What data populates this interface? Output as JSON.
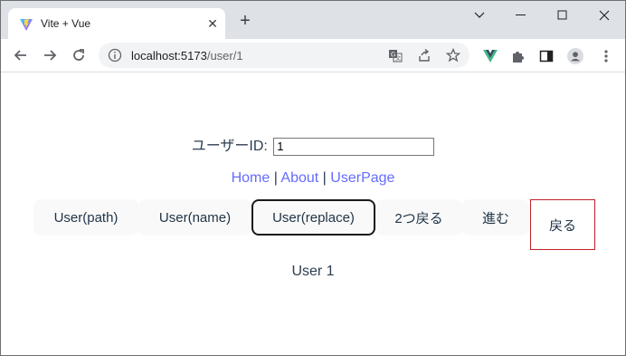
{
  "browser": {
    "tab_title": "Vite + Vue",
    "tab_close_icon": "close-icon",
    "new_tab_icon": "plus-icon",
    "url_host": "localhost:5173",
    "url_path": "/user/1"
  },
  "page": {
    "user_id_label": "ユーザーID:",
    "user_id_value": "1",
    "nav": {
      "home": "Home",
      "sep1": " | ",
      "about": "About",
      "sep2": " | ",
      "userpage": "UserPage"
    },
    "buttons": {
      "user_path": "User(path)",
      "user_name": "User(name)",
      "user_replace": "User(replace)",
      "go_back_two": "2つ戻る",
      "forward": "進む",
      "back": "戻る"
    },
    "result": "User 1"
  },
  "colors": {
    "link": "#646cff",
    "button_bg": "#f9f9f9",
    "hover_border": "#c0202a"
  }
}
